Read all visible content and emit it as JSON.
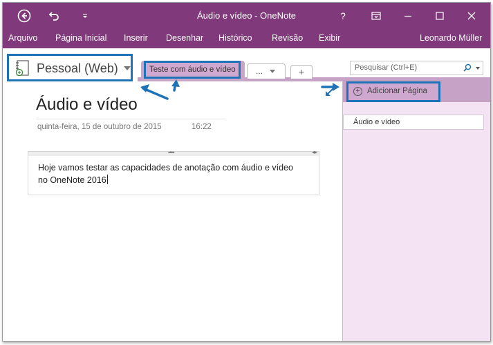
{
  "window": {
    "title": "Áudio e vídeo - OneNote",
    "help": "?",
    "colors": {
      "titlebar": "#80397b",
      "highlight_box": "#1e72b8",
      "section_tab": "#c9a7c9",
      "pane_bg": "#f4e3f2"
    }
  },
  "titlebar_icons": [
    "back-icon",
    "undo-icon",
    "quick-access-dropdown-icon",
    "help-icon",
    "ribbon-display-icon",
    "minimize-icon",
    "maximize-icon",
    "close-icon"
  ],
  "menu": {
    "items": [
      "Arquivo",
      "Página Inicial",
      "Inserir",
      "Desenhar",
      "Histórico",
      "Revisão",
      "Exibir"
    ],
    "user": "Leonardo Müller"
  },
  "notebook": {
    "name": "Pessoal (Web)"
  },
  "sections": {
    "active": "Teste com áudio e vídeo",
    "more": "...",
    "add": "+"
  },
  "search": {
    "placeholder": "Pesquisar (Ctrl+E)"
  },
  "page": {
    "title": "Áudio e vídeo",
    "date": "quinta-feira, 15 de outubro de 2015",
    "time": "16:22",
    "note_line1": "Hoje vamos testar as capacidades de anotação com áudio e vídeo",
    "note_line2": "no OneNote 2016"
  },
  "pages_pane": {
    "add_page": "Adicionar Página",
    "items": [
      "Áudio e vídeo"
    ]
  }
}
